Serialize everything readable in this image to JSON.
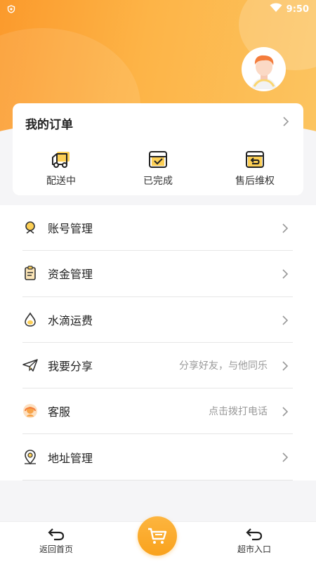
{
  "status_bar": {
    "time": "9:50"
  },
  "profile": {
    "avatar_icon": "user-avatar"
  },
  "orders": {
    "title": "我的订单",
    "items": [
      {
        "label": "配送中",
        "icon": "truck-icon"
      },
      {
        "label": "已完成",
        "icon": "box-check-icon"
      },
      {
        "label": "售后维权",
        "icon": "return-icon"
      }
    ]
  },
  "menu": [
    {
      "label": "账号管理",
      "hint": "",
      "icon": "account-icon"
    },
    {
      "label": "资金管理",
      "hint": "",
      "icon": "clipboard-icon"
    },
    {
      "label": "水滴运费",
      "hint": "",
      "icon": "droplet-icon"
    },
    {
      "label": "我要分享",
      "hint": "分享好友，与他同乐",
      "icon": "paper-plane-icon"
    },
    {
      "label": "客服",
      "hint": "点击拨打电话",
      "icon": "headset-icon"
    },
    {
      "label": "地址管理",
      "hint": "",
      "icon": "location-pin-icon"
    }
  ],
  "bottom_nav": {
    "home_label": "返回首页",
    "market_label": "超市入口",
    "cart_icon": "cart-icon"
  },
  "colors": {
    "accent": "#fba42a",
    "accent_light": "#fcc460"
  }
}
